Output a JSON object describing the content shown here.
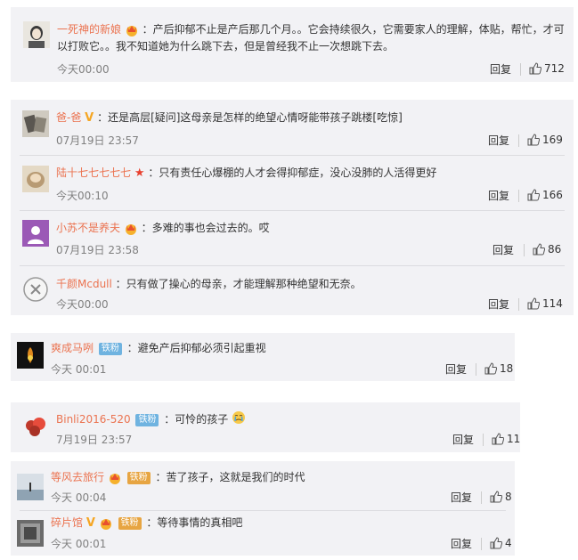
{
  "reply_label": "回复",
  "comments": [
    {
      "username": "一死神的新娘",
      "text": "：产后抑郁不止是产后那几个月。。它会持续很久，它需要家人的理解，体贴，帮忙，才可",
      "text2": "以打败它。。我不知道她为什么跳下去，但是曾经我不止一次想跳下去。",
      "time": "今天00:00",
      "likes": "712"
    },
    {
      "username": "爸-爸",
      "text": "：还是高层[疑问]这母亲是怎样的绝望心情呀能带孩子跳楼[吃惊]",
      "time": "07月19日 23:57",
      "likes": "169"
    },
    {
      "username": "陆十七七七七七",
      "text": "：只有责任心爆棚的人才会得抑郁症，没心没肺的人活得更好",
      "time": "今天00:10",
      "likes": "166"
    },
    {
      "username": "小苏不是养夫",
      "text": "：多难的事也会过去的。哎",
      "time": "07月19日 23:58",
      "likes": "86"
    },
    {
      "username": "千颜Mcdull",
      "text": "：只有做了操心的母亲，才能理解那种绝望和无奈。",
      "time": "今天00:00",
      "likes": "114"
    },
    {
      "username": "爽成马咧",
      "badge": "铁粉",
      "text": "：避免产后抑郁必须引起重视",
      "time": "今天 00:01",
      "likes": "18"
    },
    {
      "username": "Binli2016-520",
      "badge": "铁粉",
      "text": "：可怜的孩子",
      "time": "7月19日 23:57",
      "likes": "11"
    },
    {
      "username": "等风去旅行",
      "badge": "铁粉",
      "text": "：苦了孩子，这就是我们的时代",
      "time": "今天 00:04",
      "likes": "8"
    },
    {
      "username": "碎片馆",
      "badge": "铁粉",
      "text": "：等待事情的真相吧",
      "time": "今天 00:01",
      "likes": "4"
    }
  ]
}
